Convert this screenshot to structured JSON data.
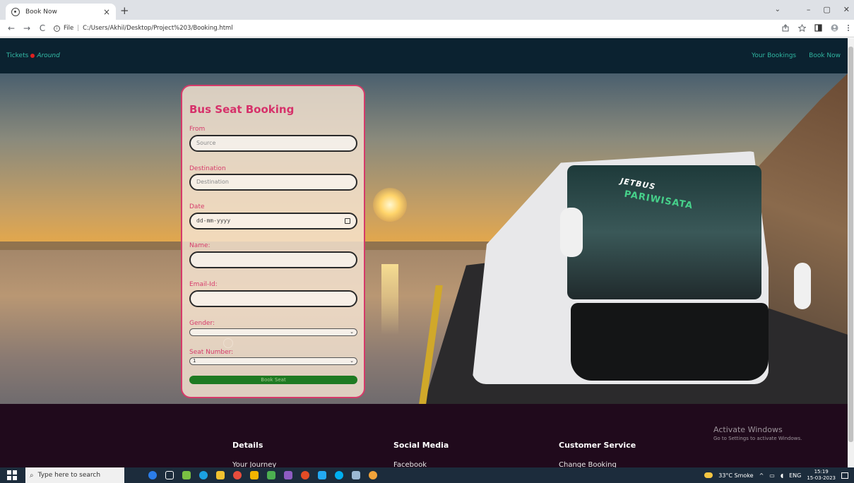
{
  "browser": {
    "tab_title": "Book Now",
    "tab_close": "×",
    "new_tab": "+",
    "nav_back": "←",
    "nav_forward": "→",
    "nav_reload": "C",
    "info": "i",
    "scheme": "File",
    "separator": "|",
    "url": "C:/Users/Akhil/Desktop/Project%203/Booking.html",
    "tab_dropdown": "⌄",
    "win_min": "–",
    "win_restore": "▢",
    "win_close": "✕"
  },
  "nav": {
    "brand_first": "Tickets",
    "brand_second": "Around",
    "links": [
      "Your Bookings",
      "Book Now"
    ]
  },
  "hero": {
    "bus_text_1": "JETBUS",
    "bus_text_2": "PARIWISATA"
  },
  "form": {
    "title": "Bus Seat Booking",
    "from_label": "From",
    "from_placeholder": "Source",
    "destination_label": "Destination",
    "destination_placeholder": "Destination",
    "date_label": "Date",
    "date_placeholder": "dd-mm-yyyy",
    "name_label": "Name:",
    "email_label": "Email-Id:",
    "gender_label": "Gender:",
    "gender_value": "",
    "seat_label": "Seat Number:",
    "seat_value": "1",
    "submit_label": "Book Seat"
  },
  "footer": {
    "columns": [
      {
        "heading": "Details",
        "link": "Your Journey"
      },
      {
        "heading": "Social Media",
        "link": "Facebook"
      },
      {
        "heading": "Customer Service",
        "link": "Change Booking"
      }
    ],
    "activate_title": "Activate Windows",
    "activate_sub": "Go to Settings to activate Windows."
  },
  "taskbar": {
    "search_placeholder": "Type here to search",
    "weather": "33°C  Smoke",
    "lang": "ENG",
    "time": "15:19",
    "date": "15-03-2023"
  },
  "colors": {
    "nav_bg": "#0b2230",
    "accent_teal": "#2fb5a0",
    "form_accent": "#d63a6a",
    "book_button": "#1e7a22",
    "footer_bg": "#200a1c"
  }
}
